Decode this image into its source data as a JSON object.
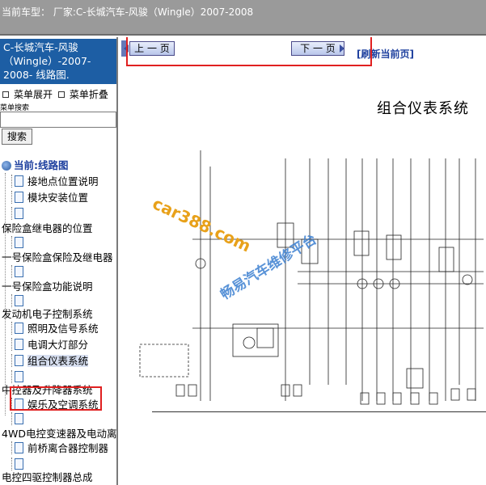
{
  "header": {
    "title": "当前车型： 厂家:C-长城汽车-风骏（Wingle）2007-2008"
  },
  "sidebar": {
    "model_title": "C-长城汽车-风骏（Wingle）-2007-2008- 线路图.",
    "expand_label": "菜单展开",
    "collapse_label": "菜单折叠",
    "search_label": "菜单搜索",
    "search_value": "",
    "search_button": "搜索",
    "current_label": "当前:线路图",
    "items": [
      {
        "label": "接地点位置说明"
      },
      {
        "label": "模块安装位置"
      },
      {
        "label": "保险盒继电器的位置"
      },
      {
        "label": "一号保险盒保险及继电器"
      },
      {
        "label": "一号保险盒功能说明"
      },
      {
        "label": "发动机电子控制系统"
      },
      {
        "label": "照明及信号系统"
      },
      {
        "label": "电调大灯部分"
      },
      {
        "label": "组合仪表系统"
      },
      {
        "label": "中控器及升降器系统"
      },
      {
        "label": "娱乐及空调系统"
      },
      {
        "label": "4WD电控变速器及电动离"
      },
      {
        "label": "前桥离合器控制器"
      },
      {
        "label": "电控四驱控制器总成"
      }
    ]
  },
  "viewer": {
    "prev_label": "上 一 页",
    "next_label": "下 一 页",
    "refresh_label": "[刷新当前页]",
    "page_title": "组合仪表系统",
    "watermark_1": "car388.com",
    "watermark_2": "畅易汽车维修平台"
  },
  "colors": {
    "header_bg": "#9a9a9a",
    "model_box_bg": "#1d5ea4",
    "highlight_frame": "#e02020",
    "link_blue": "#1d3f9e"
  }
}
